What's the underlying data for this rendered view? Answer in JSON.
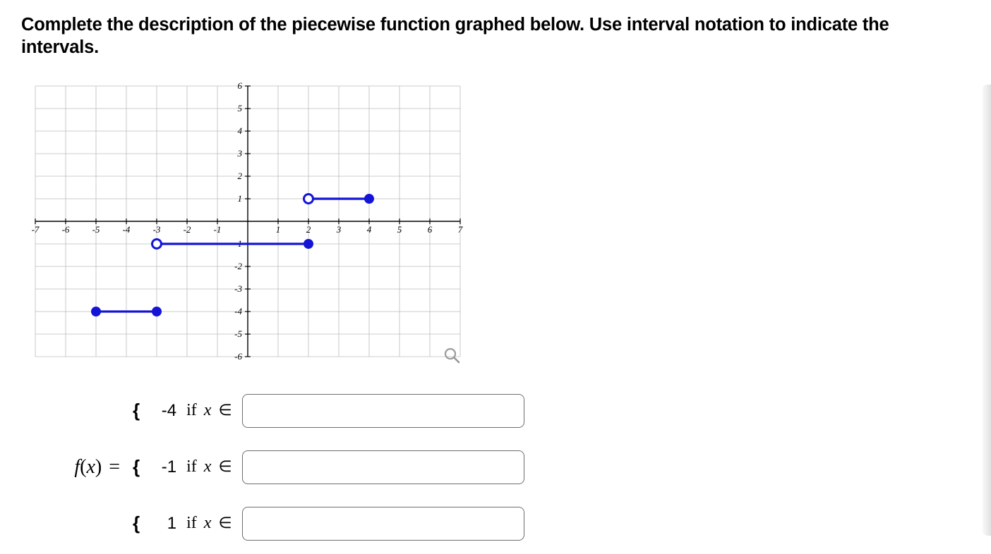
{
  "question": "Complete the description of the piecewise function graphed below. Use interval notation to indicate the intervals.",
  "fx_label": "f(x) =",
  "pieces": [
    {
      "brace": "{",
      "value": "-4",
      "if": "if",
      "var": "x",
      "elem": "∈"
    },
    {
      "brace": "{",
      "value": "-1",
      "if": "if",
      "var": "x",
      "elem": "∈"
    },
    {
      "brace": "{",
      "value": "1",
      "if": "if",
      "var": "x",
      "elem": "∈"
    }
  ],
  "chart_data": {
    "type": "line",
    "title": "",
    "xlabel": "",
    "ylabel": "",
    "xlim": [
      -7,
      7
    ],
    "ylim": [
      -6,
      6
    ],
    "xticks": [
      -7,
      -6,
      -5,
      -4,
      -3,
      -2,
      -1,
      1,
      2,
      3,
      4,
      5,
      6,
      7
    ],
    "yticks": [
      -6,
      -5,
      -4,
      -3,
      -2,
      -1,
      1,
      2,
      3,
      4,
      5,
      6
    ],
    "grid": true,
    "series": [
      {
        "name": "piece1",
        "y_value": -4,
        "x_start": -5,
        "start_closed": true,
        "x_end": -3,
        "end_closed": true
      },
      {
        "name": "piece2",
        "y_value": -1,
        "x_start": -3,
        "start_closed": false,
        "x_end": 2,
        "end_closed": true
      },
      {
        "name": "piece3",
        "y_value": 1,
        "x_start": 2,
        "start_closed": false,
        "x_end": 4,
        "end_closed": true
      }
    ]
  },
  "icons": {
    "zoom": "magnifier-icon"
  }
}
